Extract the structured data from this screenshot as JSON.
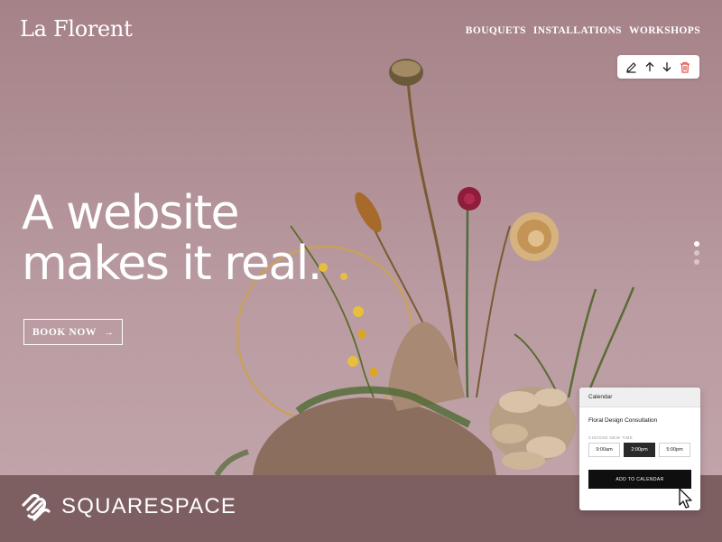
{
  "site": {
    "brand": "La Florent"
  },
  "nav": {
    "items": [
      {
        "label": "BOUQUETS"
      },
      {
        "label": "INSTALLATIONS"
      },
      {
        "label": "WORKSHOPS"
      }
    ]
  },
  "toolbar": {
    "icons": [
      "pencil-icon",
      "arrow-up-icon",
      "arrow-down-icon",
      "trash-icon"
    ],
    "delete_color": "#e0524a"
  },
  "hero": {
    "line1": "A website",
    "line2": "makes it real.",
    "cta_label": "BOOK NOW",
    "cta_arrow": "→"
  },
  "slider": {
    "count": 3,
    "active": 1
  },
  "calendar": {
    "header": "Calendar",
    "event": "Floral Design Consultation",
    "subheading": "CHOOSE NEW TIME",
    "times": [
      {
        "label": "9:00am",
        "selected": false
      },
      {
        "label": "2:00pm",
        "selected": true
      },
      {
        "label": "5:00pm",
        "selected": false
      }
    ],
    "add_button": "ADD TO CALENDAR"
  },
  "footer": {
    "wordmark": "SQUARESPACE",
    "band_color": "#7d5e61"
  },
  "colors": {
    "background": "#b08f95",
    "text": "#ffffff"
  }
}
